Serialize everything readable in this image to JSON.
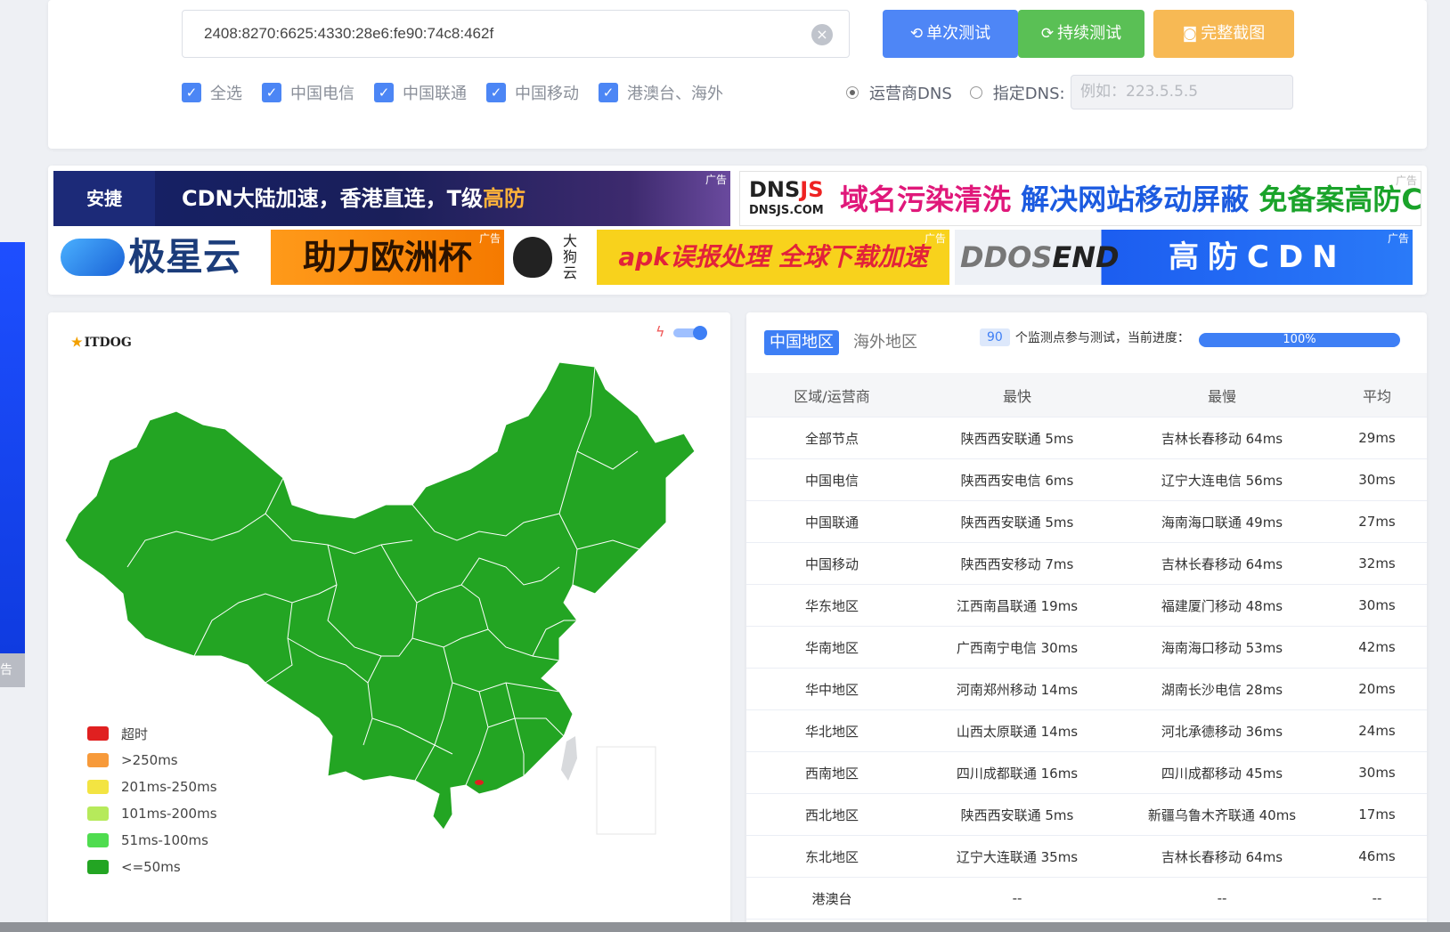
{
  "form": {
    "address_value": "2408:8270:6625:4330:28e6:fe90:74c8:462f",
    "btn_single": "单次测试",
    "btn_continuous": "持续测试",
    "btn_screenshot": "完整截图",
    "checks": [
      {
        "label": "全选",
        "checked": true
      },
      {
        "label": "中国电信",
        "checked": true
      },
      {
        "label": "中国联通",
        "checked": true
      },
      {
        "label": "中国移动",
        "checked": true
      },
      {
        "label": "港澳台、海外",
        "checked": true
      }
    ],
    "dns_options": [
      {
        "label": "运营商DNS",
        "selected": true
      },
      {
        "label": "指定DNS:",
        "selected": false
      }
    ],
    "dns_placeholder": "例如：223.5.5.5"
  },
  "ads": {
    "tag": "广告",
    "ad1_brand": "安捷",
    "ad1_text": "CDN大陆加速，香港直连，T级",
    "ad1_highlight": "高防",
    "ad2_logo": "DNS",
    "ad2_logo_js": "JS",
    "ad2_domain": "DNSJS.COM",
    "ad2_part1": "域名污染清洗",
    "ad2_part2": "解决网站移动屏蔽",
    "ad2_part3": "免备案高防CDN",
    "ad3_brand": "极星云",
    "ad3_slogan": "助力欧洲杯",
    "ad4_brand": "大狗云",
    "ad4_text": "apk误报处理 全球下载加速",
    "ad5_logo_a": "DDOS",
    "ad5_logo_b": "END",
    "ad5_text": "高防CDN",
    "edge_tag": "告"
  },
  "map": {
    "logo_text": "ITDOG",
    "legend": [
      {
        "label": "超时",
        "color": "#e02020"
      },
      {
        "label": ">250ms",
        "color": "#f79a3a"
      },
      {
        "label": "201ms-250ms",
        "color": "#f3e442"
      },
      {
        "label": "101ms-200ms",
        "color": "#b6ea5b"
      },
      {
        "label": "51ms-100ms",
        "color": "#4fdc4f"
      },
      {
        "label": "<=50ms",
        "color": "#23a523"
      }
    ],
    "fill_color": "#23a523"
  },
  "results": {
    "tabs": [
      {
        "label": "中国地区",
        "active": true
      },
      {
        "label": "海外地区",
        "active": false
      }
    ],
    "node_count": "90",
    "node_text": "个监测点参与测试，当前进度：",
    "progress_text": "100%",
    "progress_value": 1.0,
    "columns": [
      "区域/运营商",
      "最快",
      "最慢",
      "平均"
    ],
    "rows": [
      [
        "全部节点",
        "陕西西安联通 5ms",
        "吉林长春移动 64ms",
        "29ms"
      ],
      [
        "中国电信",
        "陕西西安电信 6ms",
        "辽宁大连电信 56ms",
        "30ms"
      ],
      [
        "中国联通",
        "陕西西安联通 5ms",
        "海南海口联通 49ms",
        "27ms"
      ],
      [
        "中国移动",
        "陕西西安移动 7ms",
        "吉林长春移动 64ms",
        "32ms"
      ],
      [
        "华东地区",
        "江西南昌联通 19ms",
        "福建厦门移动 48ms",
        "30ms"
      ],
      [
        "华南地区",
        "广西南宁电信 30ms",
        "海南海口移动 53ms",
        "42ms"
      ],
      [
        "华中地区",
        "河南郑州移动 14ms",
        "湖南长沙电信 28ms",
        "20ms"
      ],
      [
        "华北地区",
        "山西太原联通 14ms",
        "河北承德移动 36ms",
        "24ms"
      ],
      [
        "西南地区",
        "四川成都联通 16ms",
        "四川成都移动 45ms",
        "30ms"
      ],
      [
        "西北地区",
        "陕西西安联通 5ms",
        "新疆乌鲁木齐联通 40ms",
        "17ms"
      ],
      [
        "东北地区",
        "辽宁大连联通 35ms",
        "吉林长春移动 64ms",
        "46ms"
      ],
      [
        "港澳台",
        "--",
        "--",
        "--"
      ]
    ]
  }
}
